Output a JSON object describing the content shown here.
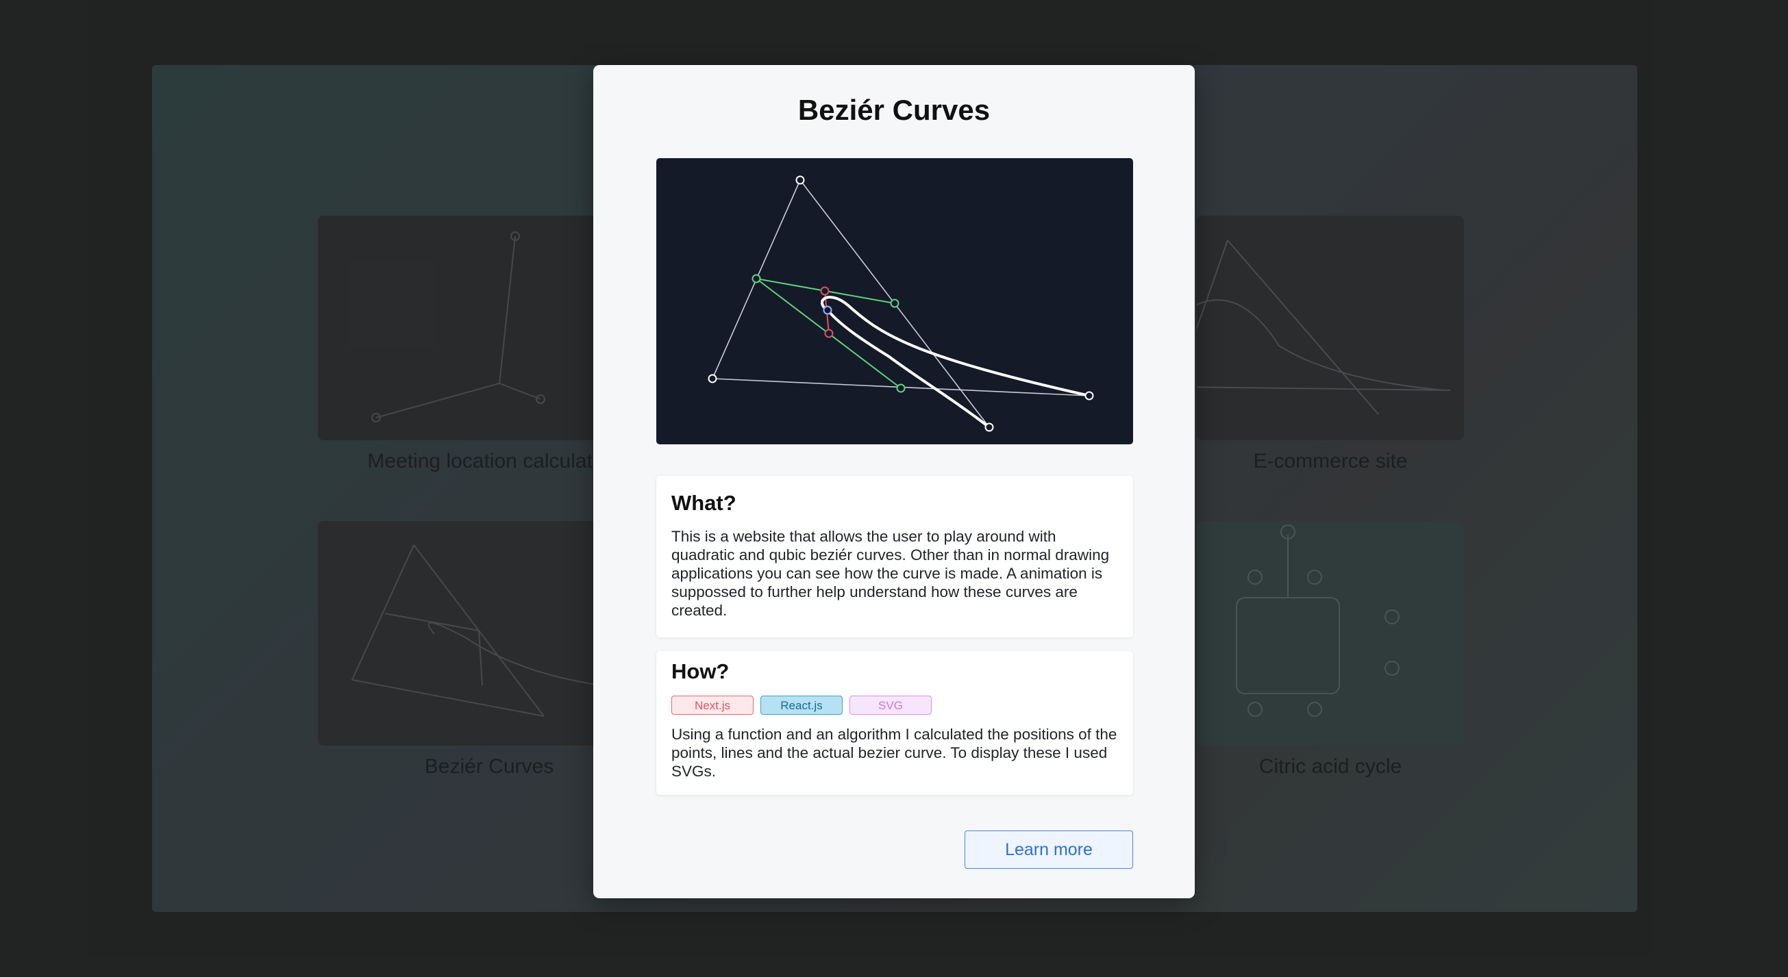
{
  "background": {
    "projects": [
      {
        "label": "Meeting location calculator"
      },
      {
        "label": "E-commerce site"
      },
      {
        "label": "Beziér Curves"
      },
      {
        "label": "Citric acid cycle"
      }
    ]
  },
  "modal": {
    "title": "Beziér Curves",
    "what": {
      "heading": "What?",
      "text": "This is a website that allows the user to play around with quadratic and qubic beziér curves. Other than in normal drawing applications you can see how the curve is made. A animation is suppossed to further help understand how these curves are created."
    },
    "how": {
      "heading": "How?",
      "tags": [
        {
          "label": "Next.js",
          "color": "#d9556a"
        },
        {
          "label": "React.js",
          "color": "#136c93"
        },
        {
          "label": "SVG",
          "color": "#cd73e2"
        }
      ],
      "text": "Using a function and an algorithm I calculated the positions of the points, lines and the actual bezier curve. To display these I used SVGs."
    },
    "learn_more_label": "Learn more"
  },
  "colors": {
    "preview_bg": "#141a28",
    "control_lines": "#c8ccd4",
    "green_points": "#5fd37f",
    "red_points": "#e0506a",
    "accent_blue": "#2b6fd9"
  }
}
